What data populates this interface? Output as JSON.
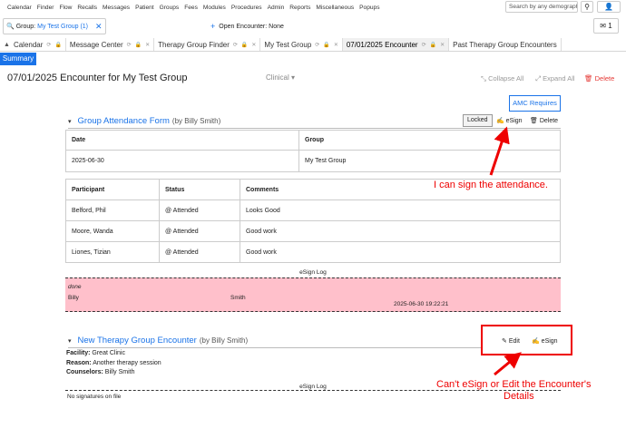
{
  "menu": [
    "Calendar",
    "Finder",
    "Flow",
    "Recalls",
    "Messages",
    "Patient",
    "Groups",
    "Fees",
    "Modules",
    "Procedures",
    "Admin",
    "Reports",
    "Miscellaneous",
    "Popups"
  ],
  "search": {
    "placeholder": "Search by any demographics"
  },
  "user_badge": "1",
  "context": {
    "group_label": "Group:",
    "group_name": "My Test Group (1)",
    "encounter_label": "Open Encounter: None"
  },
  "tabs": [
    {
      "label": "Calendar",
      "active": false
    },
    {
      "label": "Message Center",
      "active": false
    },
    {
      "label": "Therapy Group Finder",
      "active": false
    },
    {
      "label": "My Test Group",
      "active": false
    },
    {
      "label": "07/01/2025 Encounter",
      "active": true
    },
    {
      "label": "Past Therapy Group Encounters",
      "active": false
    }
  ],
  "summary_button": "Summary",
  "header": {
    "title": "07/01/2025 Encounter for My Test Group",
    "category": "Clinical",
    "collapse_all": "Collapse All",
    "expand_all": "Expand All",
    "delete": "Delete"
  },
  "amc_button": "AMC Requires",
  "attendance_form": {
    "title": "Group Attendance Form",
    "author": "(by Billy Smith)",
    "locked": "Locked",
    "esign": "eSign",
    "delete": "Delete",
    "summary_headers": [
      "Date",
      "Group"
    ],
    "summary_row": [
      "2025-06-30",
      "My Test Group"
    ],
    "participant_headers": [
      "Participant",
      "Status",
      "Comments"
    ],
    "participants": [
      [
        "Belford, Phil",
        "@ Attended",
        "Looks Good"
      ],
      [
        "Moore, Wanda",
        "@ Attended",
        "Good work"
      ],
      [
        "Liones, Tizian",
        "@ Attended",
        "Good work"
      ]
    ],
    "esign_log_title": "eSign Log",
    "esign_log": {
      "status": "done",
      "first_name": "Billy",
      "last_name": "Smith",
      "timestamp": "2025-06-30 19:22:21"
    }
  },
  "therapy_encounter": {
    "title": "New Therapy Group Encounter",
    "author": "(by Billy Smith)",
    "edit": "Edit",
    "esign": "eSign",
    "facility_label": "Facility:",
    "facility_value": "Great Clinic",
    "reason_label": "Reason:",
    "reason_value": "Another therapy session",
    "counselors_label": "Counselors:",
    "counselors_value": "Billy Smith",
    "esign_log_title": "eSign Log",
    "no_signatures": "No signatures on file"
  },
  "annotations": {
    "attendance_note": "I can sign the attendance.",
    "encounter_note_line1": "Can't eSign or Edit the Encounter's",
    "encounter_note_line2": "Details"
  },
  "colors": {
    "accent": "#1a73e8",
    "annotation": "#e00000",
    "log_bg": "#ffc0cb",
    "danger": "#e53935"
  }
}
